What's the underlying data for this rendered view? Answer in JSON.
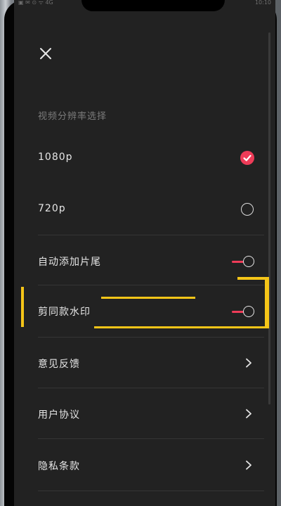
{
  "status_bar": {
    "left_text": "▣ ✉ ⊙ ᯤ 4G",
    "right_text": "10:10"
  },
  "header": {
    "close_icon": "close-icon"
  },
  "resolution": {
    "title": "视频分辨率选择",
    "options": [
      {
        "label": "1080p",
        "selected": true
      },
      {
        "label": "720p",
        "selected": false
      }
    ]
  },
  "settings": {
    "auto_outro": {
      "label": "自动添加片尾",
      "on": false
    },
    "watermark": {
      "label": "剪同款水印",
      "on": false
    },
    "feedback": {
      "label": "意见反馈"
    },
    "user_agreement": {
      "label": "用户协议"
    },
    "privacy": {
      "label": "隐私条款"
    }
  },
  "colors": {
    "accent": "#ee3c58",
    "highlight": "#f5c518",
    "background": "#222222"
  }
}
